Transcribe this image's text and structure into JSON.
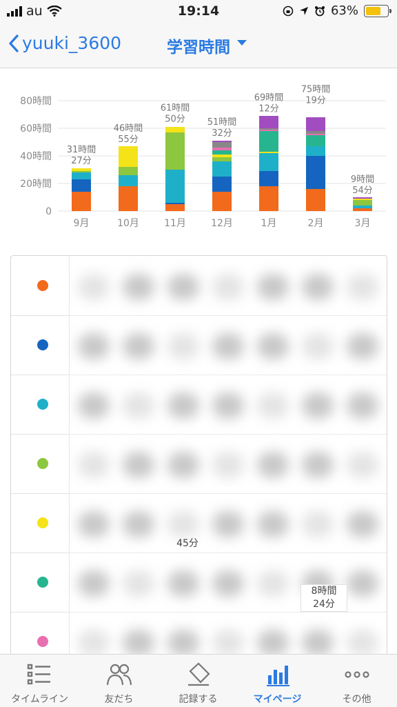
{
  "status_bar": {
    "carrier": "au",
    "time": "19:14",
    "battery": "63%"
  },
  "nav": {
    "back_label": "yuuki_3600",
    "title": "学習時間"
  },
  "chart_data": {
    "type": "bar",
    "stacked": true,
    "categories": [
      "9月",
      "10月",
      "11月",
      "12月",
      "1月",
      "2月",
      "3月"
    ],
    "totals_label": [
      "31時間\n27分",
      "46時間\n55分",
      "61時間\n50分",
      "51時間\n32分",
      "69時間\n12分",
      "75時間\n19分",
      "9時間\n54分"
    ],
    "totals": [
      31.45,
      46.92,
      61.83,
      51.53,
      69.2,
      75.32,
      9.9
    ],
    "ylim": [
      0,
      80
    ],
    "yticks": [
      0,
      20,
      40,
      60,
      80
    ],
    "ytick_labels": [
      "0",
      "20時間",
      "40時間",
      "60時間",
      "80時間"
    ],
    "grid": true,
    "series": [
      {
        "color": "#f26a1b",
        "values": [
          14,
          18,
          5,
          14,
          18,
          16,
          2
        ]
      },
      {
        "color": "#1565c0",
        "values": [
          9,
          0,
          1,
          11,
          11,
          24,
          0
        ]
      },
      {
        "color": "#1fb0c9",
        "values": [
          5,
          8,
          24,
          11,
          13,
          7,
          2
        ]
      },
      {
        "color": "#8dc63f",
        "values": [
          1,
          6,
          27,
          3,
          0,
          0,
          4
        ]
      },
      {
        "color": "#f5e31a",
        "values": [
          2,
          15,
          4,
          2,
          1,
          0,
          1
        ]
      },
      {
        "color": "#26b58f",
        "values": [
          0,
          0,
          0,
          3,
          15,
          8,
          0
        ]
      },
      {
        "color": "#e86fb0",
        "values": [
          0,
          0,
          0,
          2,
          1,
          1,
          0
        ]
      },
      {
        "color": "#888888",
        "values": [
          0,
          0,
          0,
          4,
          1,
          2,
          0
        ]
      },
      {
        "color": "#a24dbf",
        "values": [
          0,
          0,
          0,
          1,
          9,
          10,
          1
        ]
      }
    ]
  },
  "table": {
    "legend_colors": [
      "#f26a1b",
      "#1565c0",
      "#1fb0c9",
      "#8dc63f",
      "#f5e31a",
      "#26b58f",
      "#e86fb0"
    ],
    "visible_cell_time": "45分",
    "highlight_cell": {
      "line1": "8時間",
      "line2": "24分"
    }
  },
  "tabs": [
    {
      "label": "タイムライン",
      "icon": "list-icon"
    },
    {
      "label": "友だち",
      "icon": "friends-icon"
    },
    {
      "label": "記録する",
      "icon": "record-tag-icon"
    },
    {
      "label": "マイページ",
      "icon": "bar-chart-icon",
      "active": true
    },
    {
      "label": "その他",
      "icon": "more-dots-icon"
    }
  ]
}
